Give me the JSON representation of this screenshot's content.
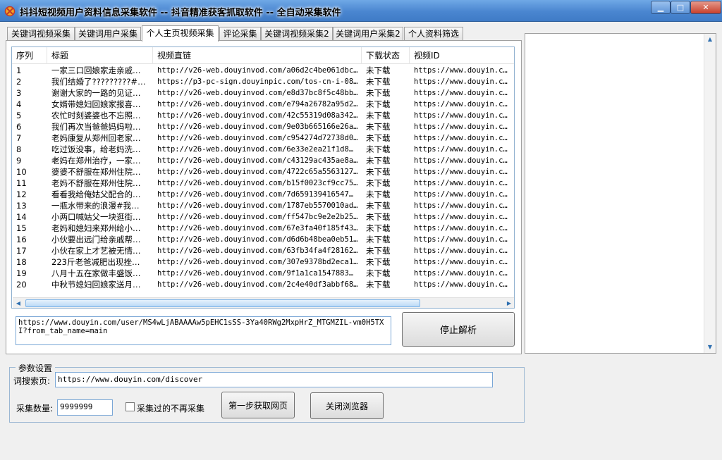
{
  "window": {
    "title": "抖抖短视频用户资料信息采集软件  --  抖音精准获客抓取软件  --  全自动采集软件",
    "minimize": "▁",
    "maximize": "□",
    "close": "✕"
  },
  "tabs": [
    {
      "label": "关键词视频采集"
    },
    {
      "label": "关键词用户采集"
    },
    {
      "label": "个人主页视频采集"
    },
    {
      "label": "评论采集"
    },
    {
      "label": "关键词视频采集2"
    },
    {
      "label": "关键词用户采集2"
    },
    {
      "label": "个人资料筛选"
    }
  ],
  "table": {
    "headers": [
      "序列",
      "标题",
      "视频直链",
      "下载状态",
      "视频ID"
    ],
    "rows": [
      {
        "seq": "1",
        "title": "一家三口回娘家走亲戚…",
        "url": "http://v26-web.douyinvod.com/a06d2c4be061dbc…",
        "status": "未下载",
        "vid": "https://www.douyin.c…"
      },
      {
        "seq": "2",
        "title": "我们结婚了?????????#…",
        "url": "https://p3-pc-sign.douyinpic.com/tos-cn-i-08…",
        "status": "未下载",
        "vid": "https://www.douyin.c…"
      },
      {
        "seq": "3",
        "title": "谢谢大家的一路的见证…",
        "url": "http://v26-web.douyinvod.com/e8d37bc8f5c48bb…",
        "status": "未下载",
        "vid": "https://www.douyin.c…"
      },
      {
        "seq": "4",
        "title": "女婿带媳妇回娘家报喜…",
        "url": "http://v26-web.douyinvod.com/e794a26782a95d2…",
        "status": "未下载",
        "vid": "https://www.douyin.c…"
      },
      {
        "seq": "5",
        "title": "农忙时刻婆婆也不忘照…",
        "url": "http://v26-web.douyinvod.com/42c55319d08a342…",
        "status": "未下载",
        "vid": "https://www.douyin.c…"
      },
      {
        "seq": "6",
        "title": "我们再次当爸爸妈妈啦…",
        "url": "http://v26-web.douyinvod.com/9e03b665166e26a…",
        "status": "未下载",
        "vid": "https://www.douyin.c…"
      },
      {
        "seq": "7",
        "title": "老妈康复从郑州回老家…",
        "url": "http://v26-web.douyinvod.com/c954274d72738d0…",
        "status": "未下载",
        "vid": "https://www.douyin.c…"
      },
      {
        "seq": "8",
        "title": "吃过饭没事，给老妈洗…",
        "url": "http://v26-web.douyinvod.com/6e33e2ea21f1d8…",
        "status": "未下载",
        "vid": "https://www.douyin.c…"
      },
      {
        "seq": "9",
        "title": "老妈在郑州治疗，一家…",
        "url": "http://v26-web.douyinvod.com/c43129ac435ae8a…",
        "status": "未下载",
        "vid": "https://www.douyin.c…"
      },
      {
        "seq": "10",
        "title": "婆婆不舒服在郑州住院…",
        "url": "http://v26-web.douyinvod.com/4722c65a5563127…",
        "status": "未下载",
        "vid": "https://www.douyin.c…"
      },
      {
        "seq": "11",
        "title": "老妈不舒服在郑州住院…",
        "url": "http://v26-web.douyinvod.com/b15f0023cf9cc75…",
        "status": "未下载",
        "vid": "https://www.douyin.c…"
      },
      {
        "seq": "12",
        "title": "看看我给俺姑父配合的…",
        "url": "http://v26-web.douyinvod.com/7d659139416547…",
        "status": "未下载",
        "vid": "https://www.douyin.c…"
      },
      {
        "seq": "13",
        "title": "一瓶水带来的浪漫#我…",
        "url": "http://v26-web.douyinvod.com/1787eb5570010ad…",
        "status": "未下载",
        "vid": "https://www.douyin.c…"
      },
      {
        "seq": "14",
        "title": "小两口喊姑父一块逛街…",
        "url": "http://v26-web.douyinvod.com/ff547bc9e2e2b25…",
        "status": "未下载",
        "vid": "https://www.douyin.c…"
      },
      {
        "seq": "15",
        "title": "老妈和媳妇来郑州给小…",
        "url": "http://v26-web.douyinvod.com/67e3fa40f185f43…",
        "status": "未下载",
        "vid": "https://www.douyin.c…"
      },
      {
        "seq": "16",
        "title": "小伙要出远门给亲戚帮…",
        "url": "http://v26-web.douyinvod.com/d6d6b48bea0eb51…",
        "status": "未下载",
        "vid": "https://www.douyin.c…"
      },
      {
        "seq": "17",
        "title": "小伙在家上才艺被无情…",
        "url": "http://v26-web.douyinvod.com/63fb34fa4f28162…",
        "status": "未下载",
        "vid": "https://www.douyin.c…"
      },
      {
        "seq": "18",
        "title": "223斤老爸减肥出现挫…",
        "url": "http://v26-web.douyinvod.com/307e9378bd2eca1…",
        "status": "未下载",
        "vid": "https://www.douyin.c…"
      },
      {
        "seq": "19",
        "title": "八月十五在家做丰盛饭…",
        "url": "http://v26-web.douyinvod.com/9f1a1ca1547883…",
        "status": "未下载",
        "vid": "https://www.douyin.c…"
      },
      {
        "seq": "20",
        "title": "中秋节媳妇回娘家送月…",
        "url": "http://v26-web.douyinvod.com/2c4e40df3abbf68…",
        "status": "未下载",
        "vid": "https://www.douyin.c…"
      }
    ]
  },
  "scroll": {
    "left": "◀",
    "right": "▶",
    "up": "▲",
    "down": "▼"
  },
  "url_box": {
    "value": "https://www.douyin.com/user/MS4wLjABAAAAw5pEHC1sSS-3Ya40RWg2MxpHrZ_MTGMZIL-vm0H5TXI?from_tab_name=main"
  },
  "stop_button": "停止解析",
  "params": {
    "legend": "参数设置",
    "search_label": "词搜索页:",
    "search_value": "https://www.douyin.com/discover",
    "count_label": "采集数量:",
    "count_value": "9999999",
    "skip_label": "采集过的不再采集",
    "step1_button": "第一步获取网页",
    "close_browser_button": "关闭浏览器"
  },
  "colors": {
    "titlebar": "#4a86d0",
    "accent": "#7aa7d6"
  }
}
